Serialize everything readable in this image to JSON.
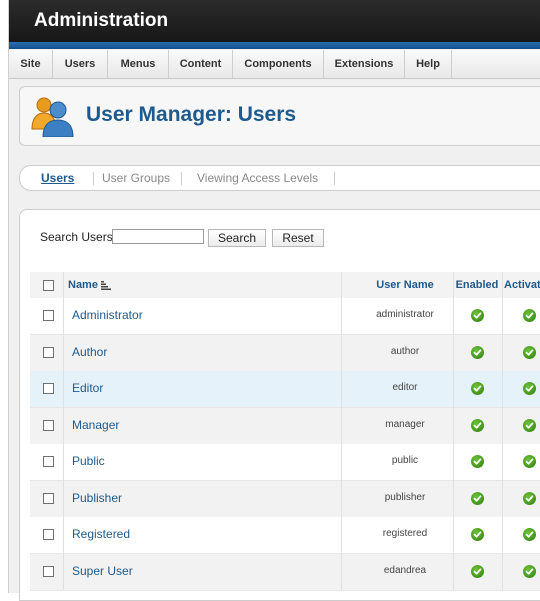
{
  "header": {
    "title": "Administration"
  },
  "menu": {
    "items": [
      "Site",
      "Users",
      "Menus",
      "Content",
      "Components",
      "Extensions",
      "Help"
    ]
  },
  "page": {
    "title": "User Manager: Users",
    "icon": "users-icon"
  },
  "subnav": {
    "items": [
      "Users",
      "User Groups",
      "Viewing Access Levels"
    ],
    "active": "Users"
  },
  "search": {
    "label": "Search Users",
    "value": "",
    "search_button": "Search",
    "reset_button": "Reset"
  },
  "table": {
    "columns": [
      "Name",
      "User Name",
      "Enabled",
      "Activated"
    ],
    "rows": [
      {
        "name": "Administrator",
        "username": "administrator",
        "enabled": true,
        "activated": true
      },
      {
        "name": "Author",
        "username": "author",
        "enabled": true,
        "activated": true
      },
      {
        "name": "Editor",
        "username": "editor",
        "enabled": true,
        "activated": true
      },
      {
        "name": "Manager",
        "username": "manager",
        "enabled": true,
        "activated": true
      },
      {
        "name": "Public",
        "username": "public",
        "enabled": true,
        "activated": true
      },
      {
        "name": "Publisher",
        "username": "publisher",
        "enabled": true,
        "activated": true
      },
      {
        "name": "Registered",
        "username": "registered",
        "enabled": true,
        "activated": true
      },
      {
        "name": "Super User",
        "username": "edandrea",
        "enabled": true,
        "activated": true
      }
    ]
  },
  "colors": {
    "accent": "#1e5a8e",
    "header_bg": "#1f1f1f",
    "stripe": "#1a5e9e",
    "check_green": "#3f9a1a"
  }
}
